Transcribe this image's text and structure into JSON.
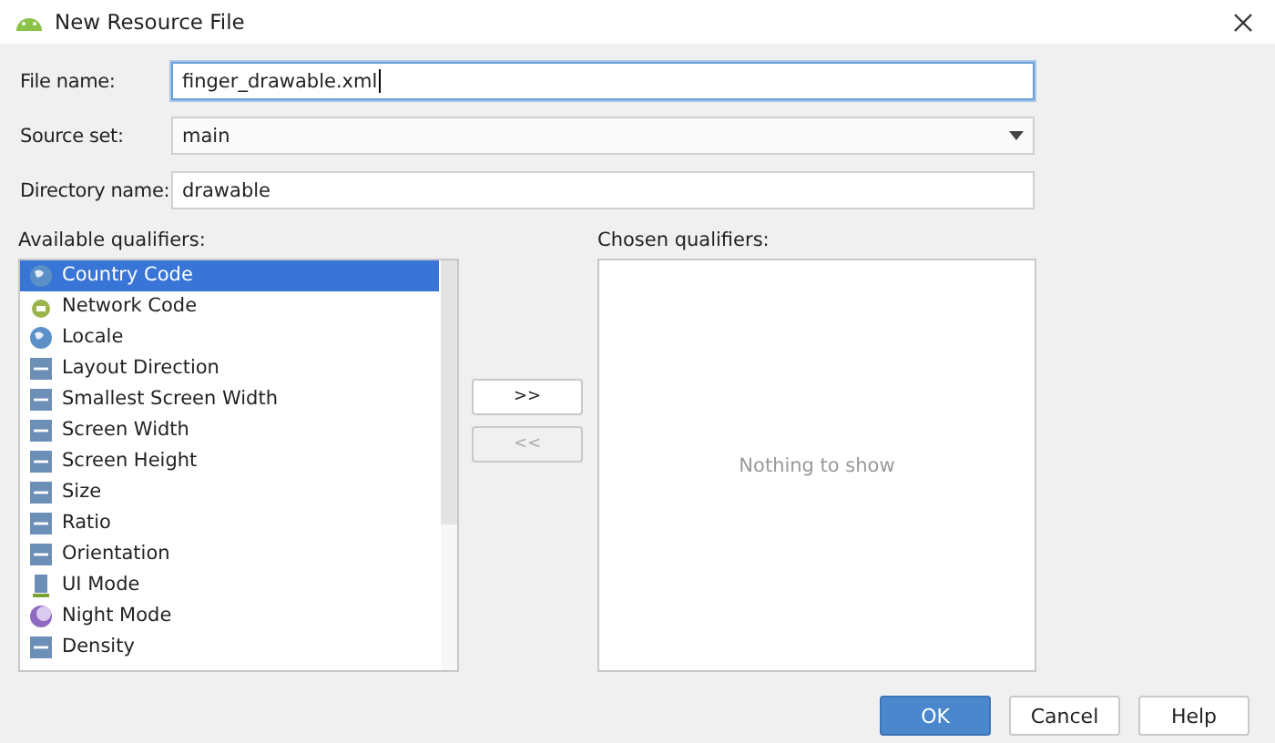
{
  "window": {
    "title": "New Resource File"
  },
  "form": [
    {
      "label": "File name:",
      "kind": "text",
      "value": "finger_drawable.xml",
      "focused": true
    },
    {
      "label": "Source set:",
      "kind": "dropdown",
      "value": "main",
      "focused": false
    },
    {
      "label": "Directory name:",
      "kind": "text",
      "value": "drawable",
      "focused": false
    }
  ],
  "available": {
    "label": "Available qualifiers:",
    "items": [
      {
        "label": "Country Code",
        "selected": true
      },
      {
        "label": "Network Code",
        "selected": false
      },
      {
        "label": "Locale",
        "selected": false
      },
      {
        "label": "Layout Direction",
        "selected": false
      },
      {
        "label": "Smallest Screen Width",
        "selected": false
      },
      {
        "label": "Screen Width",
        "selected": false
      },
      {
        "label": "Screen Height",
        "selected": false
      },
      {
        "label": "Size",
        "selected": false
      },
      {
        "label": "Ratio",
        "selected": false
      },
      {
        "label": "Orientation",
        "selected": false
      },
      {
        "label": "UI Mode",
        "selected": false
      },
      {
        "label": "Night Mode",
        "selected": false
      },
      {
        "label": "Density",
        "selected": false
      }
    ]
  },
  "transfer": [
    {
      "label": ">>",
      "disabled": false
    },
    {
      "label": "<<",
      "disabled": true
    }
  ],
  "chosen": {
    "label": "Chosen qualifiers:",
    "empty_text": "Nothing to show"
  },
  "buttons": [
    {
      "label": "OK",
      "primary": true
    },
    {
      "label": "Cancel",
      "primary": false
    },
    {
      "label": "Help",
      "primary": false
    }
  ]
}
